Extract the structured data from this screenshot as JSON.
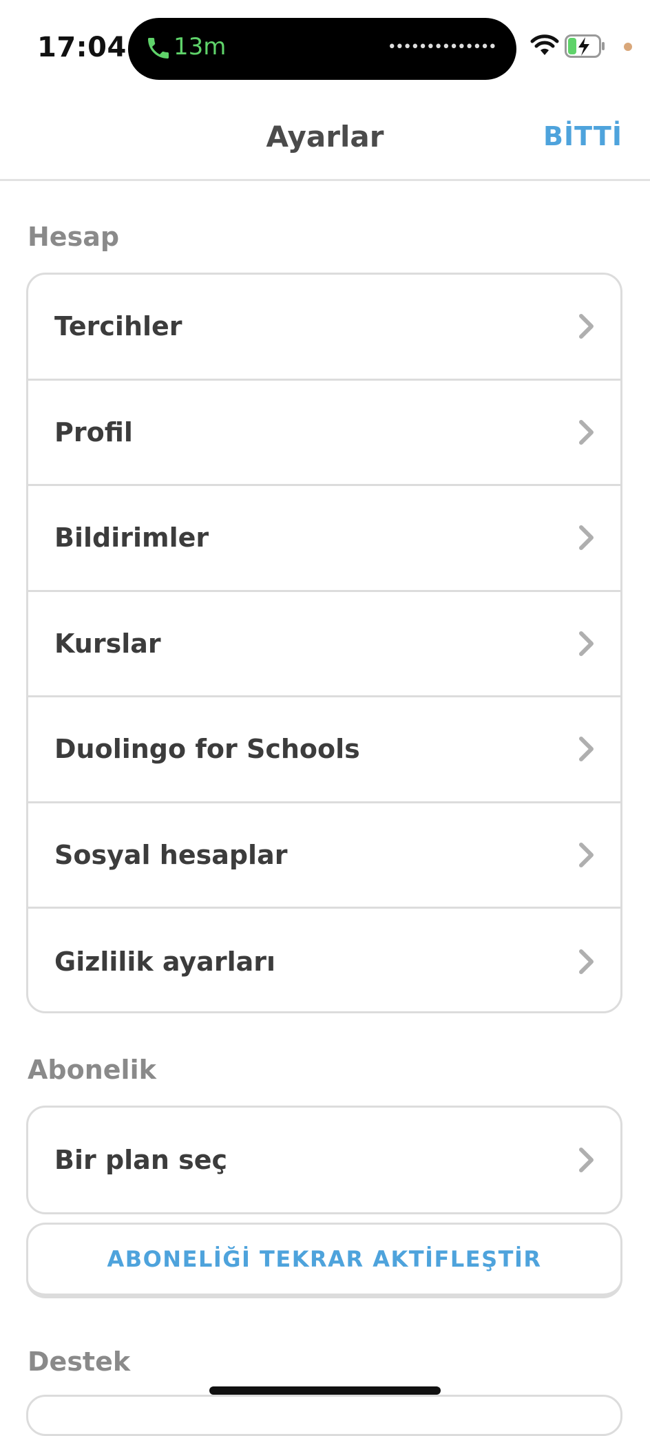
{
  "status_bar": {
    "time": "17:04",
    "call_duration": "13m",
    "call_color": "#5fd36a",
    "icons": [
      "phone-icon",
      "wifi-icon",
      "battery-charging-icon"
    ]
  },
  "header": {
    "title": "Ayarlar",
    "done_label": "BİTTİ",
    "accent_color": "#4ea3dc"
  },
  "sections": {
    "account": {
      "title": "Hesap",
      "items": [
        {
          "label": "Tercihler"
        },
        {
          "label": "Profil"
        },
        {
          "label": "Bildirimler"
        },
        {
          "label": "Kurslar"
        },
        {
          "label": "Duolingo for Schools"
        },
        {
          "label": "Sosyal hesaplar"
        },
        {
          "label": "Gizlilik ayarları"
        }
      ]
    },
    "subscription": {
      "title": "Abonelik",
      "items": [
        {
          "label": "Bir plan seç"
        }
      ],
      "reactivate_label": "ABONELİĞİ TEKRAR AKTİFLEŞTİR"
    },
    "support": {
      "title": "Destek"
    }
  }
}
